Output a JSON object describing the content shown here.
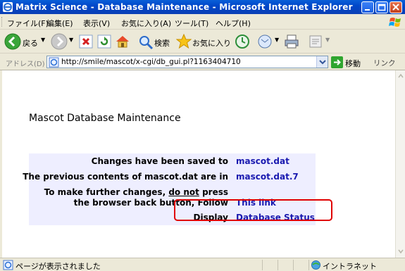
{
  "window": {
    "title": "Matrix Science - Database Maintenance - Microsoft Internet Explorer"
  },
  "menu": {
    "items": [
      "ファイル(F)",
      "編集(E)",
      "表示(V)",
      "お気に入り(A)",
      "ツール(T)",
      "ヘルプ(H)"
    ]
  },
  "toolbar": {
    "back_label": "戻る",
    "search_label": "検索",
    "favorites_label": "お気に入り"
  },
  "address": {
    "label": "アドレス(D)",
    "url": "http://smile/mascot/x-cgi/db_gui.pl?1163404710",
    "go_label": "移動",
    "links_label": "リンク"
  },
  "page": {
    "heading": "Mascot Database Maintenance",
    "rows": [
      {
        "label": "Changes have been saved to",
        "value": "mascot.dat"
      },
      {
        "label": "The previous contents of mascot.dat are in",
        "value": "mascot.dat.7"
      },
      {
        "label_part1": "To make further changes,",
        "label_underlined": "do not",
        "label_part2": "press",
        "label_line2": "the browser back button, Follow",
        "value": "This link"
      },
      {
        "label": "Display",
        "value": "Database Status"
      }
    ]
  },
  "status": {
    "text": "ページが表示されました",
    "zone": "イントラネット"
  },
  "colors": {
    "title_bar": "#0047c9",
    "table_bg": "#eeeeff",
    "link": "#1a1ab0",
    "highlight": "#e00000"
  }
}
